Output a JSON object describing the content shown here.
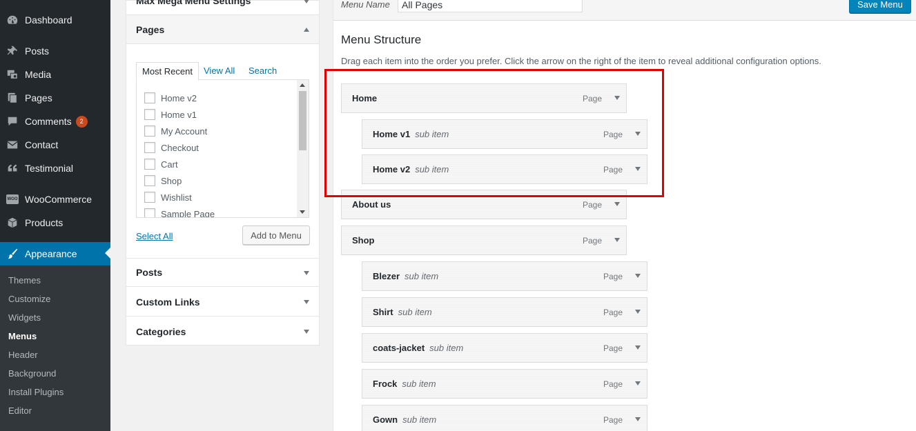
{
  "sidebar": {
    "items": [
      {
        "label": "Dashboard",
        "icon": "dashboard-icon"
      },
      {
        "label": "Posts",
        "icon": "pin-icon"
      },
      {
        "label": "Media",
        "icon": "media-icon"
      },
      {
        "label": "Pages",
        "icon": "pages-icon"
      },
      {
        "label": "Comments",
        "icon": "comment-icon",
        "badge": "2"
      },
      {
        "label": "Contact",
        "icon": "envelope-icon"
      },
      {
        "label": "Testimonial",
        "icon": "quote-icon"
      },
      {
        "label": "WooCommerce",
        "icon": "woocommerce-icon",
        "icon_text": "WOO"
      },
      {
        "label": "Products",
        "icon": "box-icon"
      },
      {
        "label": "Appearance",
        "icon": "brush-icon"
      }
    ],
    "submenu": [
      "Themes",
      "Customize",
      "Widgets",
      "Menus",
      "Header",
      "Background",
      "Install Plugins",
      "Editor"
    ]
  },
  "panel": {
    "top_section": "Max Mega Menu Settings",
    "pages_section": "Pages",
    "tabs": [
      "Most Recent",
      "View All",
      "Search"
    ],
    "pages": [
      "Home v2",
      "Home v1",
      "My Account",
      "Checkout",
      "Cart",
      "Shop",
      "Wishlist",
      "Sample Page"
    ],
    "select_all": "Select All",
    "add_to_menu": "Add to Menu",
    "other_sections": [
      "Posts",
      "Custom Links",
      "Categories"
    ]
  },
  "main": {
    "menu_name_label": "Menu Name",
    "menu_name_value": "All Pages",
    "save_button": "Save Menu",
    "structure_title": "Menu Structure",
    "structure_desc": "Drag each item into the order you prefer. Click the arrow on the right of the item to reveal additional configuration options.",
    "items": [
      {
        "title": "Home",
        "sub": "",
        "type": "Page"
      },
      {
        "title": "Home v1",
        "sub": "sub item",
        "type": "Page"
      },
      {
        "title": "Home v2",
        "sub": "sub item",
        "type": "Page"
      },
      {
        "title": "About us",
        "sub": "",
        "type": "Page"
      },
      {
        "title": "Shop",
        "sub": "",
        "type": "Page"
      },
      {
        "title": "Blezer",
        "sub": "sub item",
        "type": "Page"
      },
      {
        "title": "Shirt",
        "sub": "sub item",
        "type": "Page"
      },
      {
        "title": "coats-jacket",
        "sub": "sub item",
        "type": "Page"
      },
      {
        "title": "Frock",
        "sub": "sub item",
        "type": "Page"
      },
      {
        "title": "Gown",
        "sub": "sub item",
        "type": "Page"
      }
    ]
  },
  "colors": {
    "sidebar_bg": "#23282d",
    "active_bg": "#0073aa",
    "badge": "#ca4a1f",
    "highlight": "#e00000",
    "save_button": "#0085ba"
  }
}
